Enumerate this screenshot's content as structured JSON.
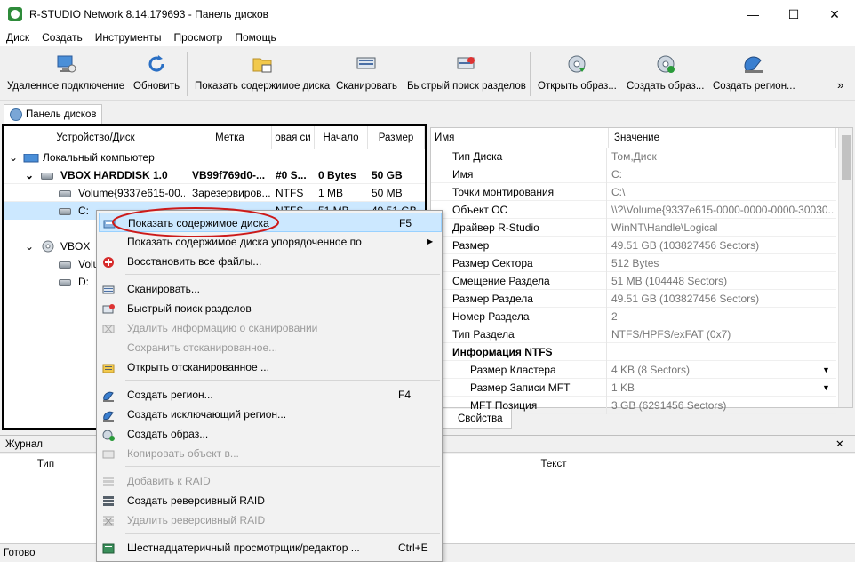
{
  "window": {
    "title": "R-STUDIO Network 8.14.179693 - Панель дисков",
    "minimize": "—",
    "maximize": "☐",
    "close": "✕"
  },
  "menu": [
    "Диск",
    "Создать",
    "Инструменты",
    "Просмотр",
    "Помощь"
  ],
  "toolbar": {
    "remote": "Удаленное подключение",
    "refresh": "Обновить",
    "show_contents": "Показать содержимое диска",
    "scan": "Сканировать",
    "quick_search": "Быстрый поиск разделов",
    "open_image": "Открыть образ...",
    "create_image": "Создать образ...",
    "create_region": "Создать регион...",
    "more": "»"
  },
  "tab": {
    "label": "Панель дисков"
  },
  "disk_panel": {
    "headers": {
      "device": "Устройство/Диск",
      "label": "Метка",
      "fs": "овая си",
      "start": "Начало",
      "size": "Размер"
    },
    "rows": [
      {
        "name": "Локальный компьютер",
        "label": "",
        "fs": "",
        "start": "",
        "size": ""
      },
      {
        "name": "VBOX HARDDISK 1.0",
        "label": "VB99f769d0-...",
        "fs": "#0 S...",
        "start": "0 Bytes",
        "size": "50 GB"
      },
      {
        "name": "Volume{9337e615-00...",
        "label": "Зарезервиров...",
        "fs": "NTFS",
        "start": "1 MB",
        "size": "50 MB"
      },
      {
        "name": "C:",
        "label": "",
        "fs": "NTFS",
        "start": "51 MB",
        "size": "49.51 GB"
      },
      {
        "name": "VBOX",
        "label": "",
        "fs": "",
        "start": "",
        "size": ""
      },
      {
        "name": "Volu",
        "label": "",
        "fs": "",
        "start": "",
        "size": ""
      },
      {
        "name": "D:",
        "label": "",
        "fs": "",
        "start": "",
        "size": ""
      }
    ]
  },
  "properties": {
    "headers": {
      "name": "Имя",
      "value": "Значение"
    },
    "rows": [
      {
        "name": "Тип Диска",
        "value": "Том,Диск"
      },
      {
        "name": "Имя",
        "value": "C:"
      },
      {
        "name": "Точки монтирования",
        "value": "C:\\"
      },
      {
        "name": "Объект ОС",
        "value": "\\\\?\\Volume{9337e615-0000-0000-0000-30030..."
      },
      {
        "name": "Драйвер R-Studio",
        "value": "WinNT\\Handle\\Logical"
      },
      {
        "name": "Размер",
        "value": "49.51 GB (103827456 Sectors)"
      },
      {
        "name": "Размер Сектора",
        "value": "512 Bytes"
      },
      {
        "name": "Смещение Раздела",
        "value": "51 MB (104448 Sectors)"
      },
      {
        "name": "Размер Раздела",
        "value": "49.51 GB (103827456 Sectors)"
      },
      {
        "name": "Номер Раздела",
        "value": "2"
      },
      {
        "name": "Тип Раздела",
        "value": "NTFS/HPFS/exFAT (0x7)"
      },
      {
        "name": "Информация NTFS",
        "value": ""
      },
      {
        "name": "Размер Кластера",
        "value": "4 KB (8 Sectors)"
      },
      {
        "name": "Размер Записи MFT",
        "value": "1 KB"
      },
      {
        "name": "MFT Позиция",
        "value": "3 GB (6291456 Sectors)"
      }
    ],
    "tab": "Свойства"
  },
  "journal": {
    "title": "Журнал",
    "col_type": "Тип",
    "col_text": "Текст",
    "close": "✕"
  },
  "status": {
    "text": "Готово"
  },
  "context_menu": {
    "items": [
      {
        "label": "Показать содержимое диска",
        "shortcut": "F5",
        "disabled": false,
        "icon": "disk-contents-icon"
      },
      {
        "label": "Показать содержимое диска упорядоченное по",
        "shortcut": "",
        "disabled": false,
        "icon": "",
        "submenu": "▶"
      },
      {
        "label": "Восстановить все файлы...",
        "shortcut": "",
        "disabled": false,
        "icon": "restore-icon"
      },
      {
        "label": "Сканировать...",
        "shortcut": "",
        "disabled": false,
        "icon": "scan-icon"
      },
      {
        "label": "Быстрый поиск разделов",
        "shortcut": "",
        "disabled": false,
        "icon": "quick-search-icon"
      },
      {
        "label": "Удалить информацию о сканировании",
        "shortcut": "",
        "disabled": true,
        "icon": "delete-scan-icon"
      },
      {
        "label": "Сохранить отсканированное...",
        "shortcut": "",
        "disabled": true,
        "icon": ""
      },
      {
        "label": "Открыть отсканированное ...",
        "shortcut": "",
        "disabled": false,
        "icon": "open-scan-icon"
      },
      {
        "label": "Создать регион...",
        "shortcut": "F4",
        "disabled": false,
        "icon": "region-icon"
      },
      {
        "label": "Создать исключающий регион...",
        "shortcut": "",
        "disabled": false,
        "icon": "exclude-region-icon"
      },
      {
        "label": "Создать образ...",
        "shortcut": "",
        "disabled": false,
        "icon": "image-icon"
      },
      {
        "label": "Копировать объект в...",
        "shortcut": "",
        "disabled": true,
        "icon": "copy-icon"
      },
      {
        "label": "Добавить к RAID",
        "shortcut": "",
        "disabled": true,
        "icon": "raid-add-icon"
      },
      {
        "label": "Создать реверсивный RAID",
        "shortcut": "",
        "disabled": false,
        "icon": "raid-create-icon"
      },
      {
        "label": "Удалить реверсивный RAID",
        "shortcut": "",
        "disabled": true,
        "icon": "raid-delete-icon"
      },
      {
        "label": "Шестнадцатеричный просмотрщик/редактор ...",
        "shortcut": "Ctrl+E",
        "disabled": false,
        "icon": "hex-icon"
      }
    ]
  },
  "colors": {
    "accent": "#cce8ff",
    "highlight_ring": "#cc1a1a",
    "selected_row": "#cce8ff"
  }
}
